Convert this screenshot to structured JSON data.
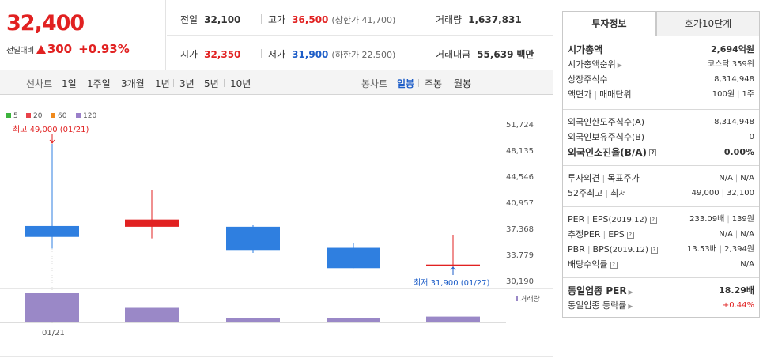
{
  "quote": {
    "price": "32,400",
    "change_label": "전일대비",
    "change": "300",
    "change_pct": "+0.93%",
    "prev_close_label": "전일",
    "prev_close": "32,100",
    "high_label": "고가",
    "high": "36,500",
    "upper_limit": "(상한가 41,700)",
    "volume_label": "거래량",
    "volume": "1,637,831",
    "open_label": "시가",
    "open": "32,350",
    "low_label": "저가",
    "low": "31,900",
    "lower_limit": "(하한가 22,500)",
    "value_label": "거래대금",
    "value": "55,639",
    "value_unit": "백만"
  },
  "tabs": {
    "line_label": "선차트",
    "line_periods": [
      "1일",
      "1주일",
      "3개월",
      "1년",
      "3년",
      "5년",
      "10년"
    ],
    "candle_label": "봉차트",
    "candle_periods": [
      "일봉",
      "주봉",
      "월봉"
    ],
    "active_candle": "일봉"
  },
  "chart_data": {
    "type": "candlestick",
    "legend": [
      "5",
      "20",
      "60",
      "120"
    ],
    "legend_colors": [
      "#3db43d",
      "#e8424a",
      "#f08a1c",
      "#9a7fc9"
    ],
    "y_ticks": [
      "51,724",
      "48,135",
      "44,546",
      "40,957",
      "37,368",
      "33,779",
      "30,190"
    ],
    "y_tick_values": [
      51724,
      48135,
      44546,
      40957,
      37368,
      33779,
      30190
    ],
    "ylim": [
      30190,
      51724
    ],
    "x_tick_label": "01/21",
    "high_annotation": "최고 49,000 (01/21)",
    "low_annotation": "최저 31,900 (01/27)",
    "volume_label": "거래량",
    "candles": [
      {
        "open": 36200,
        "close": 37700,
        "high": 49000,
        "low": 34600,
        "color": "#2f7fe0"
      },
      {
        "open": 37600,
        "close": 38600,
        "high": 42700,
        "low": 36000,
        "color": "#e12121"
      },
      {
        "open": 34400,
        "close": 37600,
        "high": 37800,
        "low": 34000,
        "color": "#2f7fe0"
      },
      {
        "open": 31900,
        "close": 34700,
        "high": 35300,
        "low": 31900,
        "color": "#2f7fe0"
      },
      {
        "open": 32350,
        "close": 32400,
        "high": 36500,
        "low": 31900,
        "color": "#e12121"
      }
    ],
    "volume_rel": [
      1.0,
      0.5,
      0.16,
      0.14,
      0.2
    ],
    "volume_color": "#9a88c7",
    "colors": {
      "up": "#e12121",
      "down": "#2f7fe0",
      "axis_text": "#555",
      "grid": "#eee"
    }
  },
  "info": {
    "tab_active": "투자정보",
    "tab_other": "호가10단계",
    "market_cap_label": "시가총액",
    "market_cap": "2,694억원",
    "rank_label": "시가총액순위",
    "rank": "코스닥 359위",
    "shares_label": "상장주식수",
    "shares": "8,314,948",
    "par_label": "액면가",
    "trade_unit_label": "매매단위",
    "par": "100원",
    "trade_unit": "1주",
    "foreign_limit_label": "외국인한도주식수(A)",
    "foreign_limit": "8,314,948",
    "foreign_hold_label": "외국인보유주식수(B)",
    "foreign_hold": "0",
    "foreign_ratio_label": "외국인소진율(B/A)",
    "foreign_ratio": "0.00%",
    "opinion_label": "투자의견",
    "target_label": "목표주가",
    "opinion": "N/A",
    "target": "N/A",
    "w52_high_label": "52주최고",
    "w52_low_label": "최저",
    "w52_high": "49,000",
    "w52_low": "32,100",
    "per_label": "PER",
    "eps_label": "EPS",
    "eps_year": "(2019.12)",
    "per": "233.09배",
    "eps": "139원",
    "est_per_label": "추정PER",
    "est_eps_label": "EPS",
    "est_per": "N/A",
    "est_eps": "N/A",
    "pbr_label": "PBR",
    "bps_label": "BPS",
    "bps_year": "(2019.12)",
    "pbr": "13.53배",
    "bps": "2,394원",
    "dividend_label": "배당수익률",
    "dividend": "N/A",
    "sector_per_label": "동일업종 PER",
    "sector_per": "18.29배",
    "sector_rate_label": "동일업종 등락률",
    "sector_rate": "+0.44%"
  }
}
